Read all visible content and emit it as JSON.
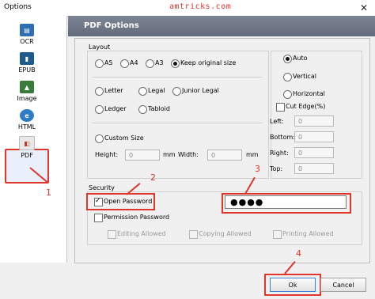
{
  "window": {
    "title": "Options",
    "watermark": "amtricks.com",
    "close": "✕"
  },
  "sidebar": {
    "items": [
      {
        "label": "OCR",
        "icon": "ocr-icon",
        "color": "#2f6db5"
      },
      {
        "label": "EPUB",
        "icon": "epub-icon",
        "color": "#1e5a8c"
      },
      {
        "label": "Image",
        "icon": "image-icon",
        "color": "#3a7d3a"
      },
      {
        "label": "HTML",
        "icon": "html-icon",
        "color": "#2e7cc8"
      },
      {
        "label": "PDF",
        "icon": "pdf-icon",
        "color": "#c0392b"
      }
    ]
  },
  "header": {
    "title": "PDF Options"
  },
  "layout": {
    "title": "Layout",
    "sizes": [
      "A5",
      "A4",
      "A3",
      "Keep original size"
    ],
    "sizes2": [
      "Letter",
      "Legal",
      "Junior Legal"
    ],
    "sizes3": [
      "Ledger",
      "Tabloid"
    ],
    "custom_size": "Custom Size",
    "height_label": "Height:",
    "height_value": "0",
    "mm1": "mm",
    "width_label": "Width:",
    "width_value": "0",
    "mm2": "mm",
    "orientation": [
      "Auto",
      "Vertical",
      "Horizontal"
    ],
    "cut_edge": "Cut Edge(%)",
    "edges": [
      {
        "label": "Left:",
        "value": "0"
      },
      {
        "label": "Bottom:",
        "value": "0"
      },
      {
        "label": "Right:",
        "value": "0"
      },
      {
        "label": "Top:",
        "value": "0"
      }
    ]
  },
  "security": {
    "title": "Security",
    "open_password": "Open Password",
    "password_value": "●●●●",
    "permission_password": "Permission Password",
    "editing": "Editing Allowed",
    "copying": "Copying Allowed",
    "printing": "Printing Allowed"
  },
  "annotations": [
    "1",
    "2",
    "3",
    "4"
  ],
  "buttons": {
    "ok": "Ok",
    "cancel": "Cancel"
  },
  "colors": {
    "annotation_red": "#e0352b",
    "header_gray": "#6f7787"
  }
}
